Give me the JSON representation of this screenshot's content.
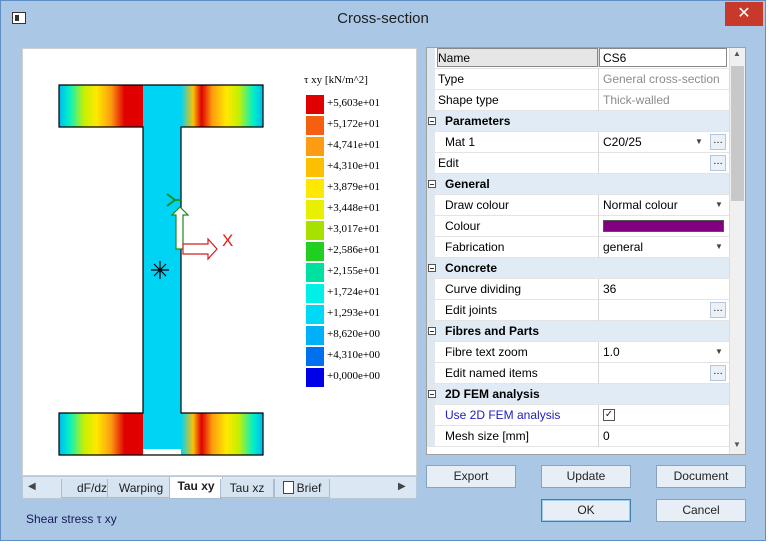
{
  "window": {
    "title": "Cross-section",
    "close_glyph": "✕"
  },
  "legend": {
    "title": "τ xy [kN/m^2]",
    "entries": [
      {
        "label": "+5,603e+01",
        "color": "#e00000"
      },
      {
        "label": "+5,172e+01",
        "color": "#f46010"
      },
      {
        "label": "+4,741e+01",
        "color": "#fc9c10"
      },
      {
        "label": "+4,310e+01",
        "color": "#fcc000"
      },
      {
        "label": "+3,879e+01",
        "color": "#ffe800"
      },
      {
        "label": "+3,448e+01",
        "color": "#e8f000"
      },
      {
        "label": "+3,017e+01",
        "color": "#a8e000"
      },
      {
        "label": "+2,586e+01",
        "color": "#20d020"
      },
      {
        "label": "+2,155e+01",
        "color": "#00e0a0"
      },
      {
        "label": "+1,724e+01",
        "color": "#00f0e8"
      },
      {
        "label": "+1,293e+01",
        "color": "#00d8f8"
      },
      {
        "label": "+8,620e+00",
        "color": "#00b0f8"
      },
      {
        "label": "+4,310e+00",
        "color": "#0070f0"
      },
      {
        "label": "+0,000e+00",
        "color": "#0000e8"
      }
    ]
  },
  "axes": {
    "x_label": "X"
  },
  "tabs": [
    {
      "label": "dF/dz",
      "active": false
    },
    {
      "label": "Warping",
      "active": false
    },
    {
      "label": "Tau xy",
      "active": true
    },
    {
      "label": "Tau xz",
      "active": false
    },
    {
      "label": "Brief",
      "active": false,
      "icon": "document-icon"
    }
  ],
  "status": {
    "text": "Shear stress τ xy"
  },
  "properties": {
    "rows": [
      {
        "type": "prop",
        "label": "Name",
        "value": "CS6",
        "selected": true
      },
      {
        "type": "prop",
        "label": "Type",
        "value": "General cross-section",
        "grey": true
      },
      {
        "type": "prop",
        "label": "Shape type",
        "value": "Thick-walled",
        "grey": true
      },
      {
        "type": "cat",
        "label": "Parameters"
      },
      {
        "type": "prop",
        "label": "Mat 1",
        "value": "C20/25",
        "dropdown": true,
        "dots": true,
        "indent": true
      },
      {
        "type": "prop",
        "label": "Edit",
        "value": "",
        "dots": true
      },
      {
        "type": "cat",
        "label": "General"
      },
      {
        "type": "prop",
        "label": "Draw colour",
        "value": "Normal colour",
        "dropdown": true,
        "indent": true
      },
      {
        "type": "prop",
        "label": "Colour",
        "value": "",
        "swatch": "#800080",
        "indent": true
      },
      {
        "type": "prop",
        "label": "Fabrication",
        "value": "general",
        "dropdown": true,
        "indent": true
      },
      {
        "type": "cat",
        "label": "Concrete"
      },
      {
        "type": "prop",
        "label": "Curve dividing",
        "value": "36",
        "indent": true
      },
      {
        "type": "prop",
        "label": "Edit joints",
        "value": "",
        "dots": true,
        "indent": true
      },
      {
        "type": "cat",
        "label": "Fibres and Parts"
      },
      {
        "type": "prop",
        "label": "Fibre text zoom",
        "value": "1.0",
        "dropdown": true,
        "indent": true
      },
      {
        "type": "prop",
        "label": "Edit named items",
        "value": "",
        "dots": true,
        "indent": true
      },
      {
        "type": "cat",
        "label": "2D FEM analysis"
      },
      {
        "type": "prop",
        "label": "Use 2D FEM analysis",
        "value": "",
        "checkbox": true,
        "checked": true,
        "indent": true,
        "blue": true
      },
      {
        "type": "prop",
        "label": "Mesh size [mm]",
        "value": "0",
        "indent": true
      }
    ]
  },
  "buttons": {
    "export": "Export",
    "update": "Update",
    "document": "Document",
    "ok": "OK",
    "cancel": "Cancel"
  },
  "colors": {
    "section_fill": "#00d4f4",
    "property_colour": "#800080"
  }
}
